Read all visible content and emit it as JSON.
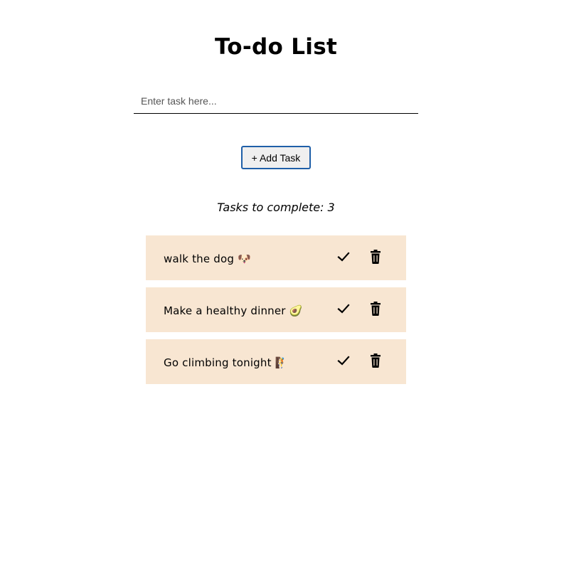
{
  "header": {
    "title": "To-do List"
  },
  "form": {
    "input_value": "",
    "input_placeholder": "Enter task here...",
    "add_button_label": "+ Add Task"
  },
  "counter": {
    "label": "Tasks to complete:",
    "count": "3"
  },
  "tasks": [
    {
      "text": "walk the dog 🐶"
    },
    {
      "text": "Make a healthy dinner 🥑"
    },
    {
      "text": "Go climbing tonight 🧗"
    }
  ],
  "icons": {
    "complete": "check-icon",
    "delete": "trash-icon"
  },
  "colors": {
    "task_background": "#f8e6d2",
    "button_border": "#1f5fa8"
  }
}
